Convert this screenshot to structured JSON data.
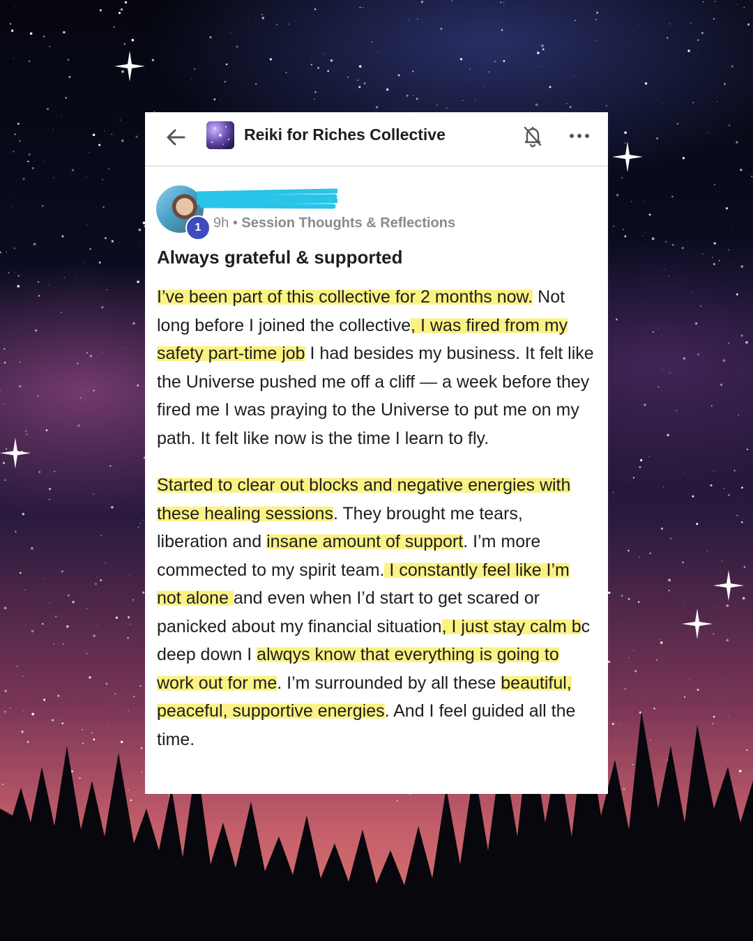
{
  "header": {
    "group_name": "Reiki for Riches Collective",
    "back_icon": "arrow-left-icon",
    "bell_icon": "bell-off-icon",
    "more_icon": "more-horizontal-icon"
  },
  "post": {
    "level": "1",
    "time": "9h",
    "separator": "•",
    "category": "Session Thoughts & Reflections",
    "title": "Always grateful & supported",
    "paragraphs": [
      [
        {
          "t": "I’ve been part of this collective for 2 months now.",
          "hl": true
        },
        {
          "t": " Not long before I joined the collective",
          "hl": false
        },
        {
          "t": ", I was fired from my safety part-time job",
          "hl": true
        },
        {
          "t": " I had besides my business. It felt like the Universe pushed me off a cliff — a week before they fired me I was praying to the Universe to put me on my path. It felt like now is the time I learn to fly.",
          "hl": false
        }
      ],
      [
        {
          "t": "Started to clear out blocks and negative energies with these healing sessions",
          "hl": true
        },
        {
          "t": ". They brought me tears, liberation and ",
          "hl": false
        },
        {
          "t": "insane amount of support",
          "hl": true
        },
        {
          "t": ". I’m more commected to my spirit team.",
          "hl": false
        },
        {
          "t": " I constantly feel like I’m not alone ",
          "hl": true
        },
        {
          "t": "and even when I’d start to get scared or panicked about my financial situation",
          "hl": false
        },
        {
          "t": ", I just stay calm b",
          "hl": true
        },
        {
          "t": "c deep down I ",
          "hl": false
        },
        {
          "t": "alwqys know that everything is going to work out for me",
          "hl": true
        },
        {
          "t": ". I’m surrounded by all these ",
          "hl": false
        },
        {
          "t": "beautiful, peaceful, supportive energies",
          "hl": true
        },
        {
          "t": ". And I feel guided all the time.",
          "hl": false
        }
      ]
    ],
    "highlight_color": "#faf06e"
  },
  "colors": {
    "card_bg": "#ffffff",
    "text": "#1e1e1e",
    "meta_text": "#8a8a8a",
    "badge": "#3d4bbf",
    "redaction": "#29c4e8"
  }
}
